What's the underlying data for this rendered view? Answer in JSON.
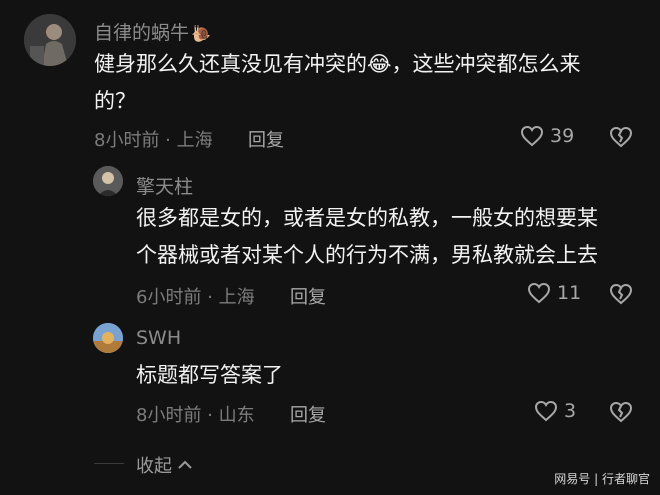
{
  "comments": [
    {
      "author": "自律的蜗牛",
      "author_emoji": "🐌",
      "text_line1_before_emoji": "健身那么久还真没见有冲突的",
      "text_emoji": "😂",
      "text_line1_after_emoji": "，这些冲突都怎么来",
      "text_line2": "的？",
      "meta": "8小时前 · 上海",
      "reply_label": "回复",
      "like_count": "39",
      "icons": [
        "heart-icon",
        "broken-heart-icon"
      ]
    }
  ],
  "replies": [
    {
      "author": "擎天柱",
      "text_line1": "很多都是女的，或者是女的私教，一般女的想要某",
      "text_line2": "个器械或者对某个人的行为不满，男私教就会上去",
      "meta": "6小时前 · 上海",
      "reply_label": "回复",
      "like_count": "11"
    },
    {
      "author": "SWH",
      "text_line1": "标题都写答案了",
      "meta": "8小时前 · 山东",
      "reply_label": "回复",
      "like_count": "3"
    }
  ],
  "collapse_label": "收起",
  "watermark": {
    "left": "网易号",
    "separator": " | ",
    "right": "行者聊官"
  },
  "colors": {
    "background": "#121212",
    "text": "#f2f2f2",
    "secondary": "#8b8b8b"
  }
}
